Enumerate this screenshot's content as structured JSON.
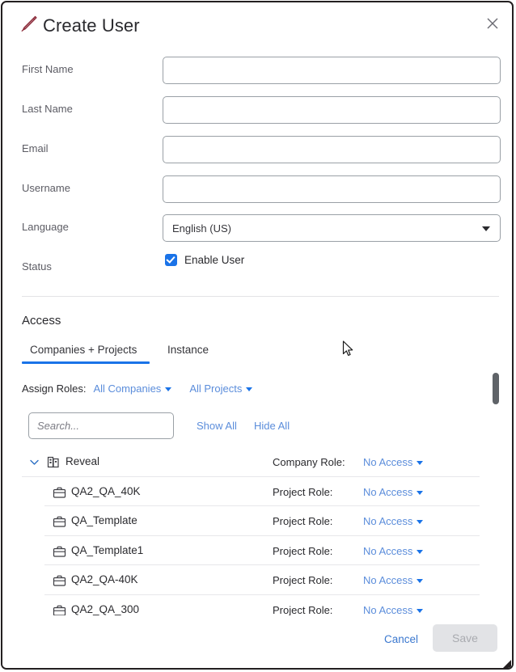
{
  "dialog": {
    "title": "Create User",
    "title_icon": "pencil-icon",
    "close_icon": "close-icon",
    "accent_color": "#1a73e8",
    "link_color": "#5b8ddb",
    "pencil_color": "#8c2b3a"
  },
  "form": {
    "fields": [
      {
        "label": "First Name",
        "value": "",
        "placeholder": ""
      },
      {
        "label": "Last Name",
        "value": "",
        "placeholder": ""
      },
      {
        "label": "Email",
        "value": "",
        "placeholder": ""
      },
      {
        "label": "Username",
        "value": "",
        "placeholder": ""
      }
    ],
    "language": {
      "label": "Language",
      "value": "English (US)",
      "caret_icon": "chevron-down-icon"
    },
    "status": {
      "label": "Status",
      "checkbox_label": "Enable User",
      "checked": true
    }
  },
  "access": {
    "heading": "Access",
    "tabs": [
      {
        "label": "Companies + Projects",
        "active": true
      },
      {
        "label": "Instance",
        "active": false
      }
    ],
    "assign_roles": {
      "label": "Assign Roles:",
      "companies_filter": "All Companies",
      "projects_filter": "All Projects"
    },
    "search": {
      "value": "",
      "placeholder": "Search..."
    },
    "show_all": "Show All",
    "hide_all": "Hide All",
    "tree": [
      {
        "type": "company",
        "name": "Reveal",
        "icon": "building-icon",
        "expanded": true,
        "expand_icon": "chevron-down-icon",
        "role_label": "Company Role:",
        "role_value": "No Access"
      },
      {
        "type": "project",
        "name": "QA2_QA_40K",
        "icon": "briefcase-icon",
        "role_label": "Project Role:",
        "role_value": "No Access"
      },
      {
        "type": "project",
        "name": "QA_Template",
        "icon": "briefcase-icon",
        "role_label": "Project Role:",
        "role_value": "No Access"
      },
      {
        "type": "project",
        "name": "QA_Template1",
        "icon": "briefcase-icon",
        "role_label": "Project Role:",
        "role_value": "No Access"
      },
      {
        "type": "project",
        "name": "QA2_QA-40K",
        "icon": "briefcase-icon",
        "role_label": "Project Role:",
        "role_value": "No Access"
      },
      {
        "type": "project",
        "name": "QA2_QA_300",
        "icon": "briefcase-icon",
        "role_label": "Project Role:",
        "role_value": "No Access"
      }
    ]
  },
  "footer": {
    "cancel_label": "Cancel",
    "save_label": "Save",
    "save_disabled": true
  }
}
